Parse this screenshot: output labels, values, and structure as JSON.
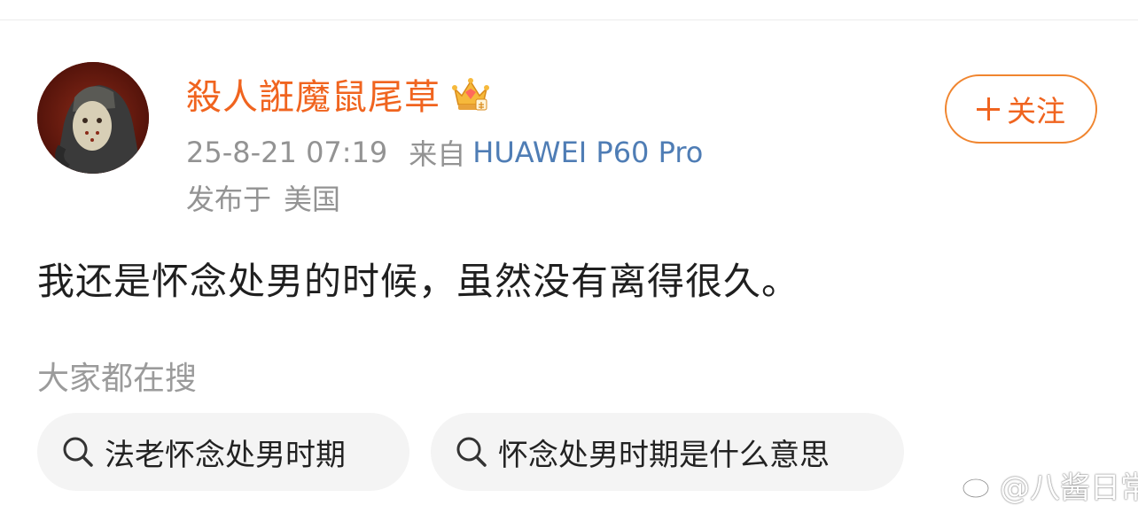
{
  "post": {
    "author": {
      "name": "殺人誑魔鼠尾草",
      "badge_icon": "crown-vip-icon"
    },
    "time": "25-8-21 07:19",
    "source_prefix": "来自",
    "device": "HUAWEI P60 Pro",
    "location_prefix": "发布于",
    "location": "美国",
    "follow_label": "关注",
    "content": "我还是怀念处男的时候，虽然没有离得很久。"
  },
  "related": {
    "heading": "大家都在搜",
    "chips": [
      {
        "label": "法老怀念处男时期",
        "icon": "search-icon"
      },
      {
        "label": "怀念处男时期是什么意思",
        "icon": "search-icon"
      }
    ]
  },
  "watermark": {
    "text": "@八酱日常",
    "icon": "weibo-logo-icon"
  },
  "colors": {
    "accent": "#f0641f",
    "device_link": "#4f7db5",
    "meta_gray": "#939393"
  }
}
